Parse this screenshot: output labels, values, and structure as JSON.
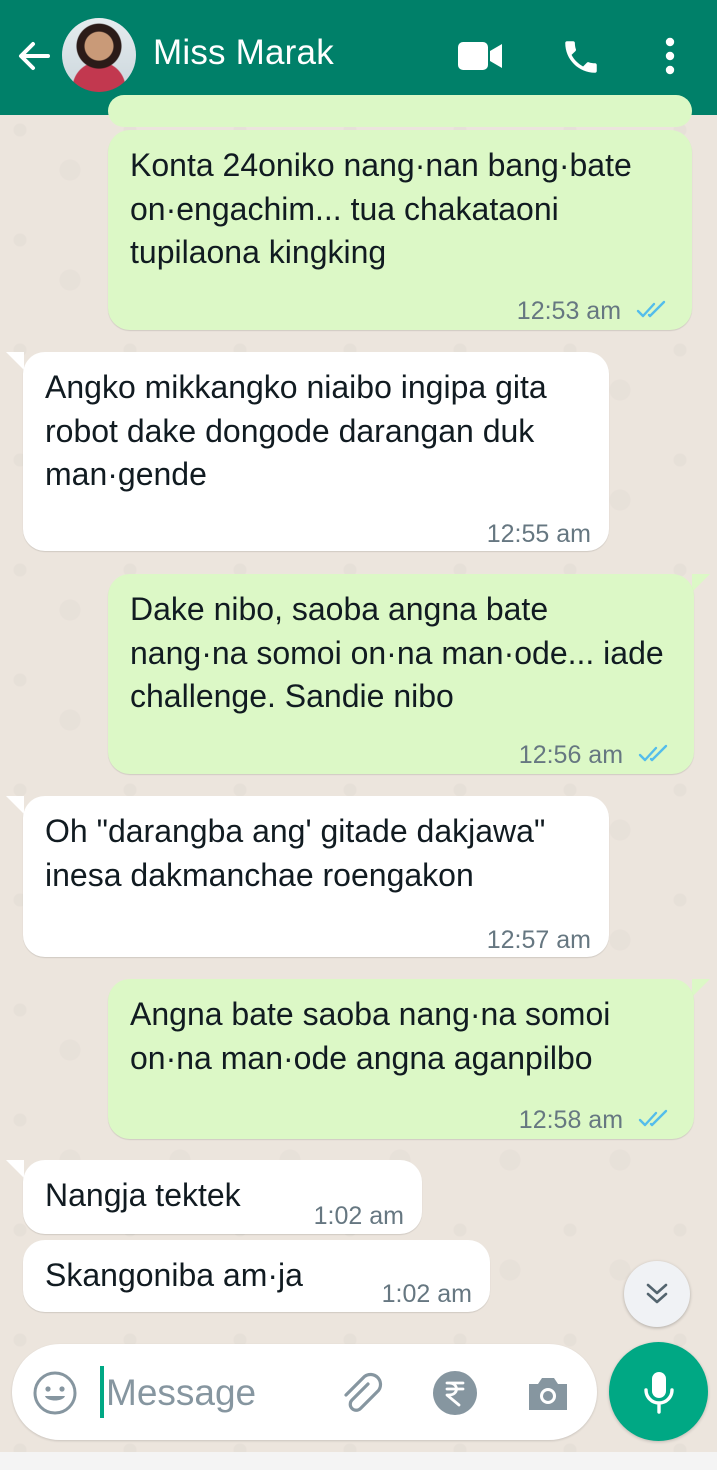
{
  "header": {
    "contact_name": "Miss Marak",
    "icons": [
      "back-arrow-icon",
      "avatar",
      "video-call-icon",
      "phone-icon",
      "more-options-icon"
    ]
  },
  "messages": [
    {
      "direction": "out",
      "text": "Konta 24oniko nang·nan bang·bate on·engachim... tua chakataoni tupilaona kingking",
      "time": "12:53 am",
      "read": true
    },
    {
      "direction": "in",
      "text": "Angko mikkangko niaibo ingipa gita robot dake dongode darangan duk man·gende",
      "time": "12:55 am"
    },
    {
      "direction": "out",
      "text": "Dake nibo, saoba angna bate nang·na somoi on·na man·ode... iade challenge. Sandie nibo",
      "time": "12:56 am",
      "read": true
    },
    {
      "direction": "in",
      "text": "Oh \"darangba ang' gitade dakjawa\" inesa dakmanchae roengakon",
      "time": "12:57 am"
    },
    {
      "direction": "out",
      "text": "Angna bate saoba nang·na somoi on·na man·ode angna aganpilbo",
      "time": "12:58 am",
      "read": true
    },
    {
      "direction": "in",
      "text": "Nangja tektek",
      "time": "1:02 am"
    },
    {
      "direction": "in",
      "text": "Skangoniba am·ja",
      "time": "1:02 am"
    }
  ],
  "composer": {
    "placeholder": "Message",
    "icons": [
      "emoji-icon",
      "attachment-icon",
      "rupee-payment-icon",
      "camera-icon",
      "microphone-icon"
    ]
  },
  "colors": {
    "header": "#008069",
    "outgoing_bubble": "#dcf8c6",
    "incoming_bubble": "#ffffff",
    "chat_background": "#ece5dd",
    "read_ticks": "#53bdeb",
    "accent": "#00a884"
  }
}
